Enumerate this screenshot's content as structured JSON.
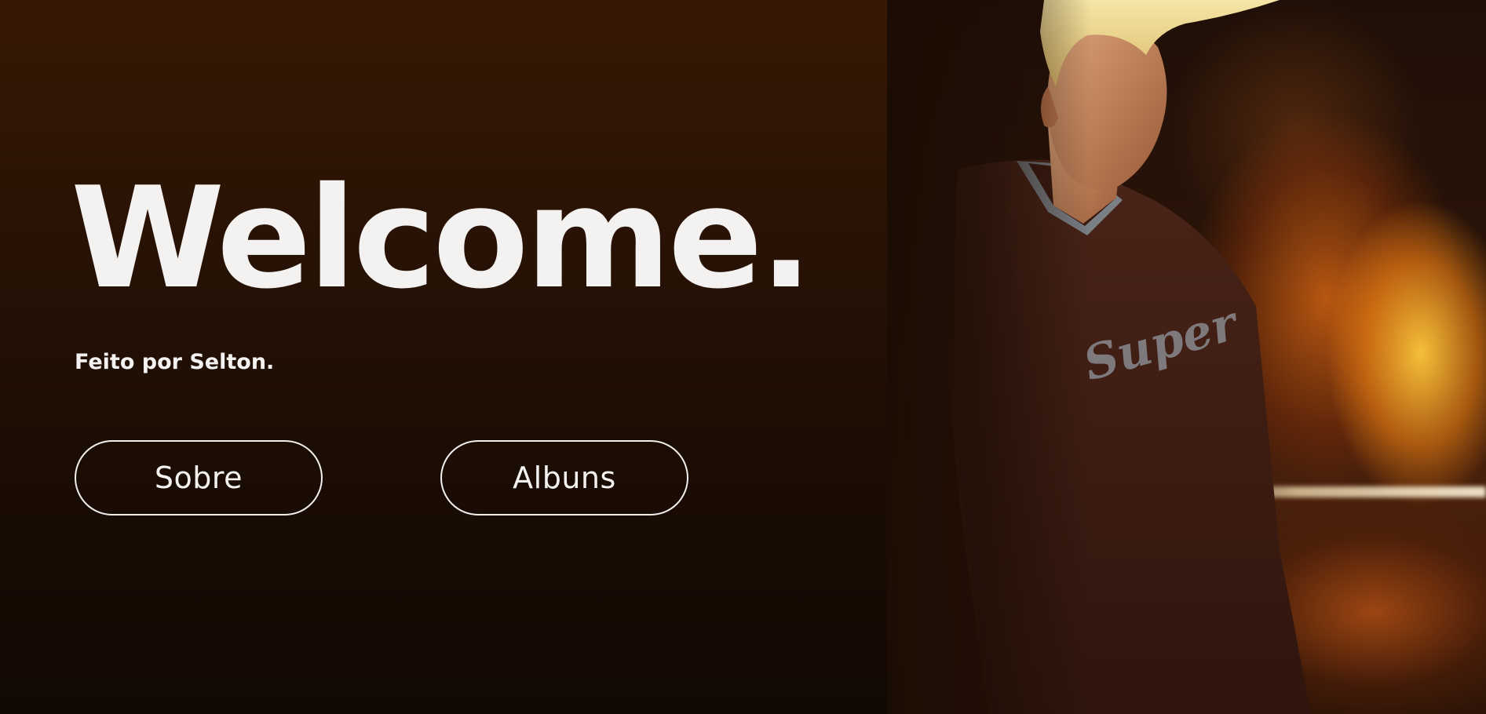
{
  "hero": {
    "title": "Welcome.",
    "subtitle": "Feito por Selton."
  },
  "buttons": {
    "sobre_label": "Sobre",
    "albuns_label": "Albuns"
  },
  "photo": {
    "shirt_text": "Super"
  },
  "colors": {
    "background_top": "#361905",
    "background_bottom": "#120903",
    "text": "#f4f2f0",
    "button_border": "#f1efed",
    "fire_accent": "#ff9a1a"
  }
}
